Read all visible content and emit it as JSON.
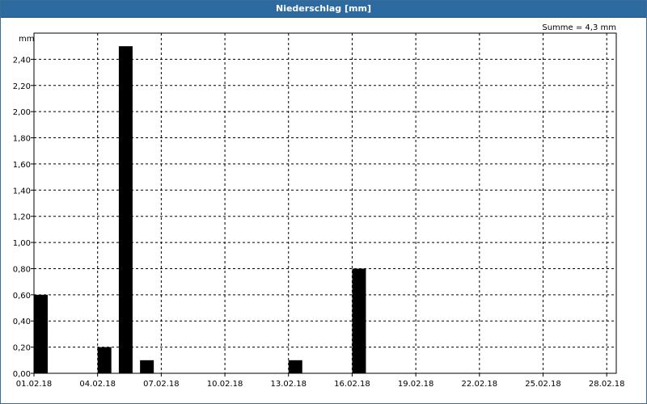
{
  "window": {
    "title": "Niederschlag [mm]"
  },
  "chart_data": {
    "type": "bar",
    "title": "Niederschlag [mm]",
    "ylabel": "mm",
    "xlabel": "",
    "annotation": "Summe = 4,3 mm",
    "ylim": [
      0,
      2.6
    ],
    "grid": true,
    "bar_color": "#000000",
    "x_ticks": [
      "01.02.18",
      "04.02.18",
      "07.02.18",
      "10.02.18",
      "13.02.18",
      "16.02.18",
      "19.02.18",
      "22.02.18",
      "25.02.18",
      "28.02.18"
    ],
    "y_ticks": [
      "0,00",
      "0,20",
      "0,40",
      "0,60",
      "0,80",
      "1,00",
      "1,20",
      "1,40",
      "1,60",
      "1,80",
      "2,00",
      "2,20",
      "2,40"
    ],
    "categories": [
      "01.02.18",
      "02.02.18",
      "03.02.18",
      "04.02.18",
      "05.02.18",
      "06.02.18",
      "07.02.18",
      "08.02.18",
      "09.02.18",
      "10.02.18",
      "11.02.18",
      "12.02.18",
      "13.02.18",
      "14.02.18",
      "15.02.18",
      "16.02.18",
      "17.02.18",
      "18.02.18",
      "19.02.18",
      "20.02.18",
      "21.02.18",
      "22.02.18",
      "23.02.18",
      "24.02.18",
      "25.02.18",
      "26.02.18",
      "27.02.18",
      "28.02.18"
    ],
    "values": [
      0.6,
      0,
      0,
      0.2,
      2.5,
      0.1,
      0,
      0,
      0,
      0,
      0,
      0,
      0.1,
      0,
      0,
      0.8,
      0,
      0,
      0,
      0,
      0,
      0,
      0,
      0,
      0,
      0,
      0,
      0
    ]
  }
}
